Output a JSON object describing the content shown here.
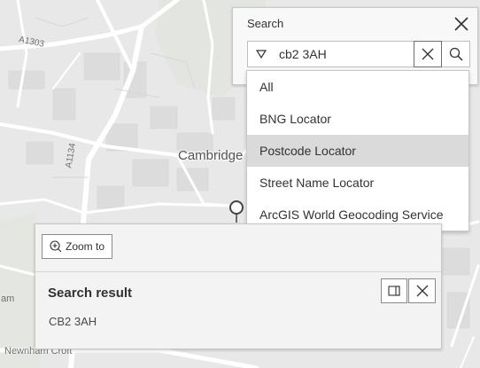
{
  "map": {
    "road_labels": [
      "A1303",
      "A1134"
    ],
    "city_label": "Cambridge",
    "street_labels": [
      "Newnham Croft"
    ],
    "edge_label": "am"
  },
  "search": {
    "title": "Search",
    "input_value": "cb2 3AH",
    "sources": [
      "All",
      "BNG Locator",
      "Postcode Locator",
      "Street Name Locator",
      "ArcGIS World Geocoding Service"
    ],
    "selected_source": "Postcode Locator"
  },
  "popup": {
    "zoom_label": "Zoom to",
    "title": "Search result",
    "content": "CB2 3AH"
  },
  "colors": {
    "map_background": "#e8e8e8",
    "road": "#ffffff",
    "selected_item": "#dadada"
  },
  "icons": {
    "toggle": "triangle-down-icon",
    "clear": "close-icon",
    "search": "search-icon",
    "zoom": "zoom-in-icon",
    "dock": "dock-icon",
    "marker": "location-marker-icon"
  }
}
